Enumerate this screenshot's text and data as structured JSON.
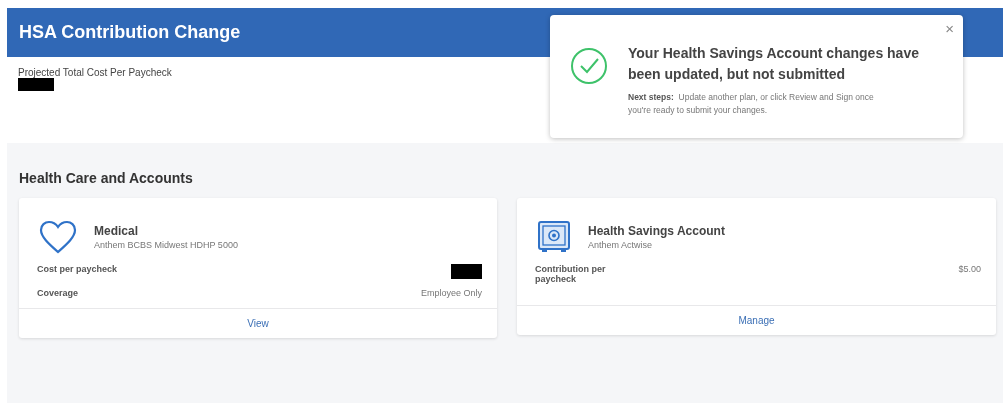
{
  "header": {
    "title": "HSA Contribution Change"
  },
  "summary": {
    "label": "Projected Total Cost Per Paycheck",
    "value": {
      "redacted": true
    }
  },
  "toast": {
    "close": "×",
    "title": "Your Health Savings Account changes have been updated, but not submitted",
    "lead": "Next steps:",
    "body": "Update another plan, or click Review and Sign once you're ready to submit your changes."
  },
  "section": {
    "title": "Health Care and Accounts"
  },
  "cards": [
    {
      "title": "Medical",
      "subtitle": "Anthem BCBS Midwest HDHP 5000",
      "rows": [
        {
          "label": "Cost per paycheck",
          "redacted": true
        },
        {
          "label": "Coverage",
          "redacted": false,
          "value": "Employee Only"
        }
      ],
      "action": "View"
    },
    {
      "title": "Health Savings Account",
      "subtitle": "Anthem Actwise",
      "rows": [
        {
          "label": "Contribution per paycheck",
          "redacted": false,
          "value": "$5.00"
        }
      ],
      "action": "Manage"
    }
  ]
}
